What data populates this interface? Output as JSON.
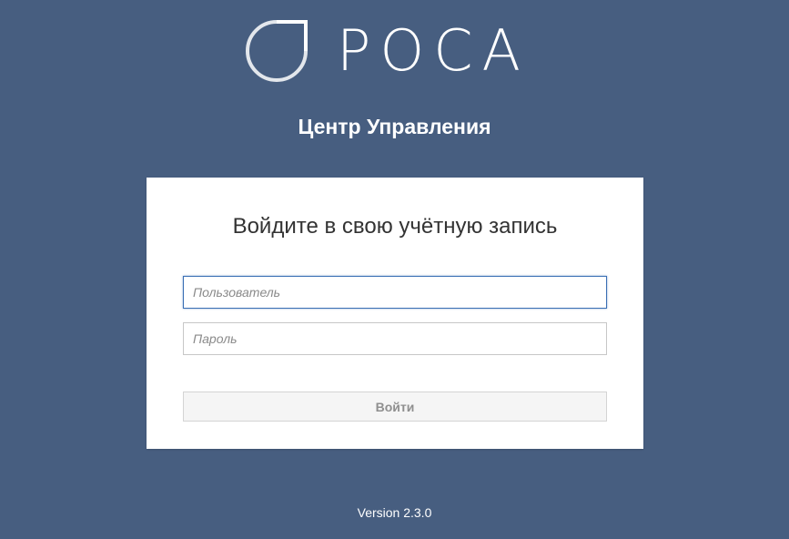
{
  "brand": {
    "logo_icon": "rosa-bracket-logo-icon",
    "name": "РОСА"
  },
  "app_title": "Центр Управления",
  "login_card": {
    "title": "Войдите в свою учётную запись",
    "username": {
      "placeholder": "Пользователь",
      "value": ""
    },
    "password": {
      "placeholder": "Пароль",
      "value": ""
    },
    "login_button_label": "Войти"
  },
  "footer": {
    "version": "Version 2.3.0"
  },
  "colors": {
    "background": "#475e80",
    "card": "#ffffff",
    "focus_border": "#3a6fb4"
  }
}
